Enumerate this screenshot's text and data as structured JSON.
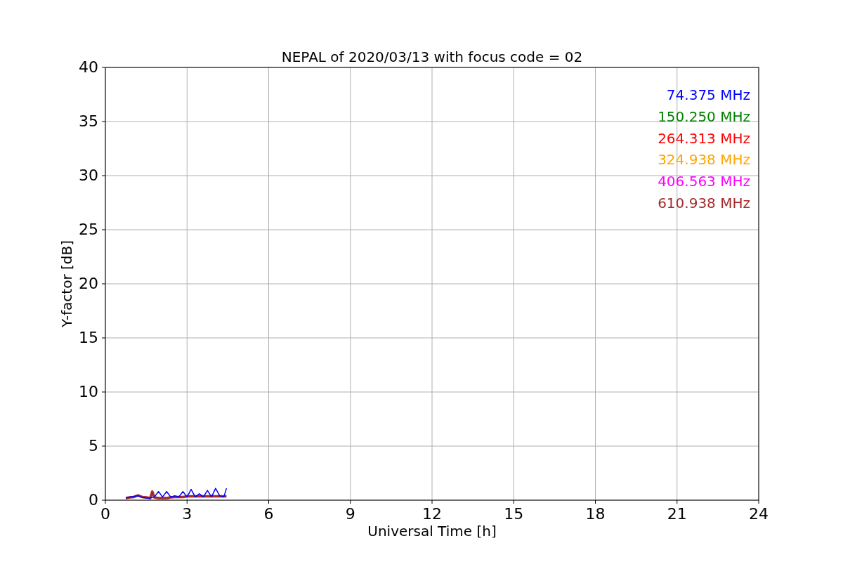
{
  "chart_data": {
    "type": "line",
    "title": "NEPAL of 2020/03/13 with focus code = 02",
    "xlabel": "Universal Time [h]",
    "ylabel": "Y-factor [dB]",
    "grid": true,
    "x": [
      0.75,
      0.9,
      1.05,
      1.2,
      1.35,
      1.5,
      1.65,
      1.72,
      1.8,
      1.95,
      2.1,
      2.25,
      2.4,
      2.55,
      2.7,
      2.85,
      3.0,
      3.15,
      3.3,
      3.45,
      3.6,
      3.75,
      3.9,
      4.05,
      4.2,
      4.35,
      4.45
    ],
    "series": [
      {
        "name": "74.375 MHz",
        "color": "#0000ff",
        "values": [
          0.2,
          0.3,
          0.35,
          0.4,
          0.25,
          0.2,
          0.2,
          0.25,
          0.3,
          0.8,
          0.3,
          0.8,
          0.3,
          0.4,
          0.3,
          0.8,
          0.3,
          1.0,
          0.3,
          0.6,
          0.3,
          0.9,
          0.3,
          1.1,
          0.4,
          0.3,
          1.1
        ]
      },
      {
        "name": "150.250 MHz",
        "color": "#008000",
        "values": [
          null,
          null,
          null,
          null,
          null,
          null,
          null,
          null,
          null,
          null,
          null,
          null,
          null,
          null,
          null,
          null,
          null,
          null,
          null,
          null,
          null,
          null,
          null,
          null,
          null,
          null,
          null
        ]
      },
      {
        "name": "264.313 MHz",
        "color": "#ff0000",
        "values": [
          null,
          null,
          null,
          null,
          null,
          null,
          null,
          null,
          null,
          null,
          null,
          null,
          null,
          null,
          null,
          null,
          null,
          null,
          null,
          null,
          null,
          null,
          null,
          null,
          null,
          null,
          null
        ]
      },
      {
        "name": "324.938 MHz",
        "color": "#ffa500",
        "values": [
          null,
          null,
          null,
          null,
          null,
          null,
          null,
          null,
          null,
          null,
          null,
          null,
          null,
          null,
          null,
          null,
          null,
          null,
          null,
          null,
          null,
          null,
          null,
          null,
          null,
          null,
          null
        ]
      },
      {
        "name": "406.563 MHz",
        "color": "#ff00ff",
        "values": [
          null,
          null,
          null,
          null,
          null,
          null,
          null,
          null,
          null,
          null,
          null,
          null,
          null,
          null,
          null,
          null,
          null,
          null,
          null,
          null,
          null,
          null,
          null,
          null,
          null,
          null,
          null
        ]
      },
      {
        "name": "610.938 MHz",
        "color": "#a52a2a",
        "values": [
          0.2,
          0.25,
          0.3,
          0.45,
          0.3,
          0.25,
          0.2,
          0.8,
          0.25,
          0.2,
          0.2,
          0.2,
          0.25,
          0.3,
          0.3,
          0.3,
          0.35,
          0.35,
          0.35,
          0.35,
          0.35,
          0.35,
          0.35,
          0.35,
          0.35,
          0.35,
          0.35
        ]
      }
    ],
    "xlim": [
      0,
      24
    ],
    "ylim": [
      0,
      40
    ],
    "xticks": [
      0,
      3,
      6,
      9,
      12,
      15,
      18,
      21,
      24
    ],
    "yticks": [
      0,
      5,
      10,
      15,
      20,
      25,
      30,
      35,
      40
    ]
  }
}
